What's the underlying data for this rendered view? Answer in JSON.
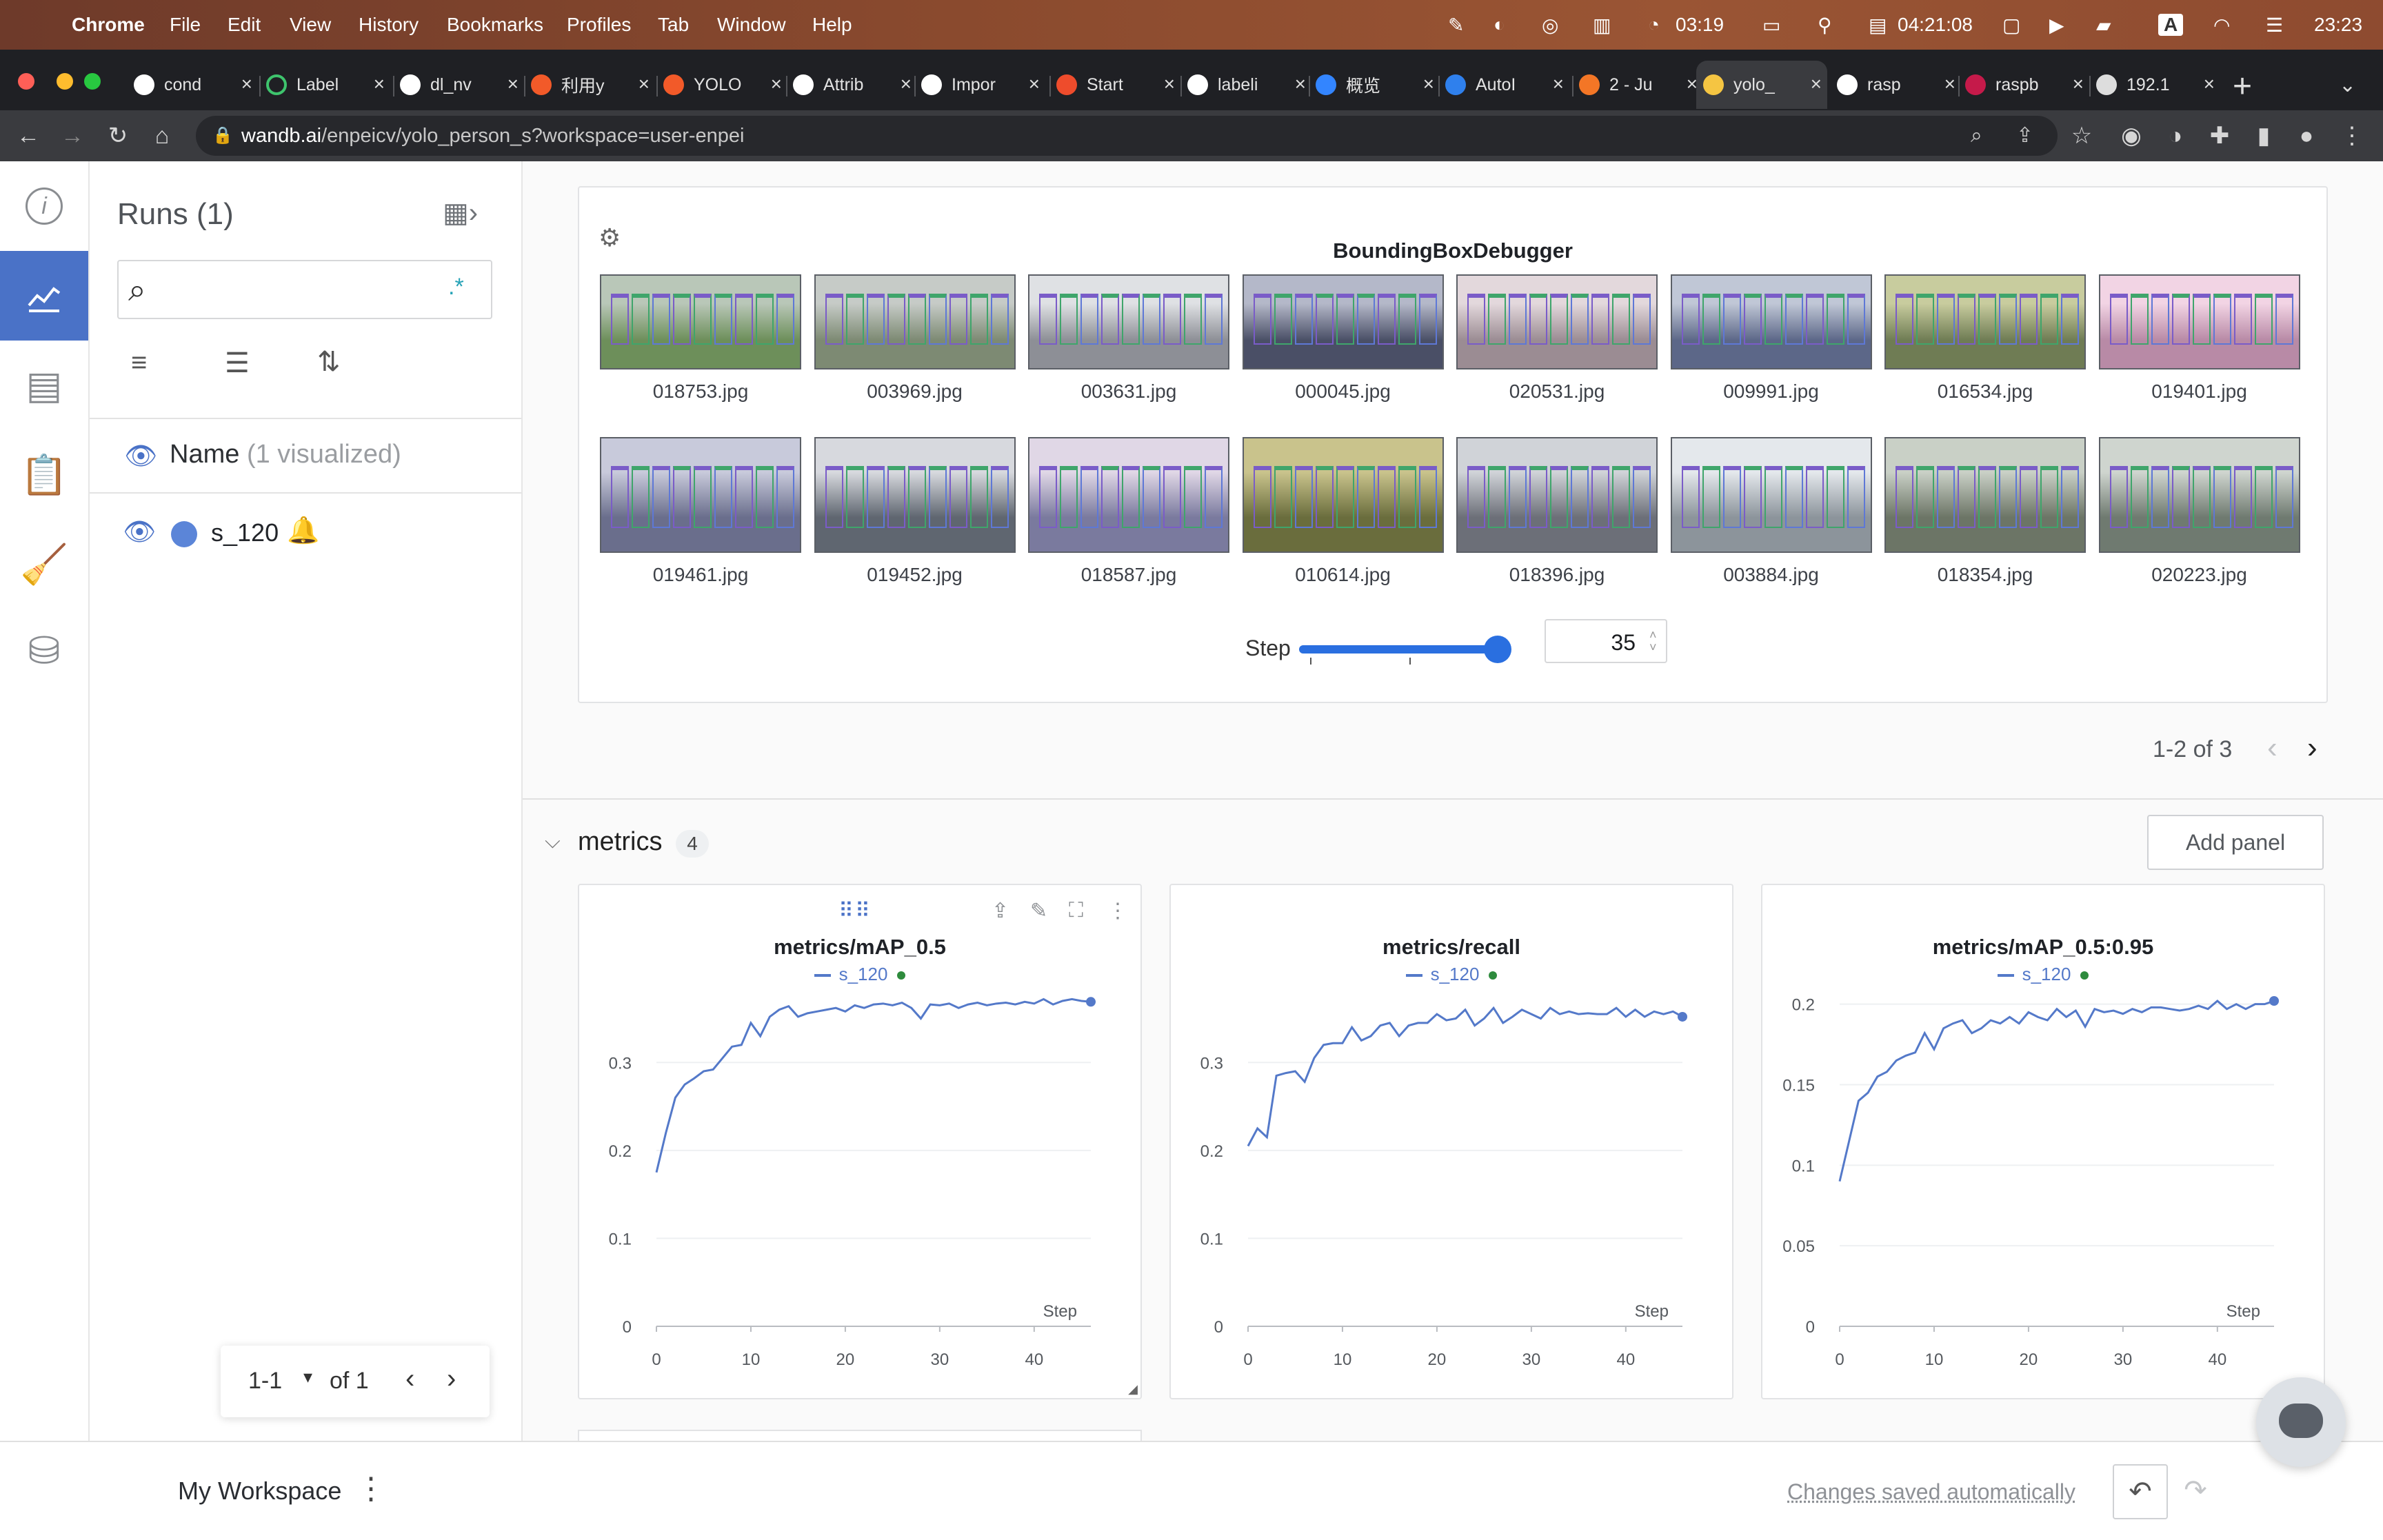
{
  "menubar": {
    "app": "Chrome",
    "items": [
      "File",
      "Edit",
      "View",
      "History",
      "Bookmarks",
      "Profiles",
      "Tab",
      "Window",
      "Help"
    ],
    "clock1": "03:19",
    "clock2": "04:21:08",
    "time": "23:23",
    "input_mode": "A"
  },
  "tabs": [
    {
      "label": "cond",
      "icon": "google-icon"
    },
    {
      "label": "Label",
      "icon": "spinner-icon"
    },
    {
      "label": "dl_nv",
      "icon": "github-icon"
    },
    {
      "label": "利用y",
      "icon": "csdn-icon"
    },
    {
      "label": "YOLO",
      "icon": "csdn-icon"
    },
    {
      "label": "Attrib",
      "icon": "google-icon"
    },
    {
      "label": "Impor",
      "icon": "github-icon"
    },
    {
      "label": "Start",
      "icon": "pytorch-icon"
    },
    {
      "label": "labeli",
      "icon": "google-icon"
    },
    {
      "label": "概览",
      "icon": "baidu-icon"
    },
    {
      "label": "AutoI",
      "icon": "vscode-icon"
    },
    {
      "label": "2 - Ju",
      "icon": "jupyter-icon"
    },
    {
      "label": "yolo_",
      "icon": "wandb-icon",
      "active": true
    },
    {
      "label": "rasp",
      "icon": "google-icon"
    },
    {
      "label": "raspb",
      "icon": "raspberry-icon"
    },
    {
      "label": "192.1",
      "icon": "page-icon"
    }
  ],
  "address": {
    "host": "wandb.ai",
    "path": "/enpeicv/yolo_person_s?workspace=user-enpei"
  },
  "runs": {
    "title": "Runs (1)",
    "column": "Name",
    "visualized": "(1 visualized)",
    "run_name": "s_120",
    "pager": {
      "range": "1-1",
      "of": "of 1"
    }
  },
  "bbox_panel": {
    "title": "BoundingBoxDebugger",
    "row1": [
      "018753.jpg",
      "003969.jpg",
      "003631.jpg",
      "000045.jpg",
      "020531.jpg",
      "009991.jpg",
      "016534.jpg",
      "019401.jpg"
    ],
    "row2": [
      "019461.jpg",
      "019452.jpg",
      "018587.jpg",
      "010614.jpg",
      "018396.jpg",
      "003884.jpg",
      "018354.jpg",
      "020223.jpg"
    ],
    "step_label": "Step",
    "step_value": "35",
    "step_fraction": 0.96
  },
  "pagination": "1-2 of 3",
  "section": {
    "title": "metrics",
    "count": "4",
    "add_panel": "Add panel"
  },
  "charts_meta": {
    "xlabel": "Step",
    "legend": "s_120",
    "line_color": "#5479c9"
  },
  "chart_data": [
    {
      "type": "line",
      "title": "metrics/mAP_0.5",
      "xlabel": "Step",
      "ylim": [
        0,
        0.37
      ],
      "xlim": [
        0,
        46
      ],
      "yticks": [
        0,
        0.1,
        0.2,
        0.3
      ],
      "ytick_labels": [
        "0",
        "0.1",
        "0.2",
        "0.3"
      ],
      "xticks": [
        0,
        10,
        20,
        30,
        40
      ],
      "series": [
        {
          "name": "s_120",
          "x": [
            0,
            1,
            2,
            3,
            4,
            5,
            6,
            7,
            8,
            9,
            10,
            11,
            12,
            13,
            14,
            15,
            16,
            17,
            18,
            19,
            20,
            21,
            22,
            23,
            24,
            25,
            26,
            27,
            28,
            29,
            30,
            31,
            32,
            33,
            34,
            35,
            36,
            37,
            38,
            39,
            40,
            41,
            42,
            43,
            44,
            45,
            46
          ],
          "values": [
            0.175,
            0.22,
            0.26,
            0.275,
            0.282,
            0.29,
            0.292,
            0.305,
            0.318,
            0.32,
            0.345,
            0.33,
            0.352,
            0.36,
            0.364,
            0.352,
            0.356,
            0.358,
            0.36,
            0.362,
            0.358,
            0.365,
            0.362,
            0.366,
            0.367,
            0.365,
            0.368,
            0.362,
            0.35,
            0.366,
            0.365,
            0.367,
            0.362,
            0.366,
            0.368,
            0.365,
            0.367,
            0.368,
            0.366,
            0.369,
            0.367,
            0.372,
            0.366,
            0.37,
            0.372,
            0.37,
            0.369
          ]
        }
      ]
    },
    {
      "type": "line",
      "title": "metrics/recall",
      "xlabel": "Step",
      "ylim": [
        0,
        0.37
      ],
      "xlim": [
        0,
        46
      ],
      "yticks": [
        0,
        0.1,
        0.2,
        0.3
      ],
      "ytick_labels": [
        "0",
        "0.1",
        "0.2",
        "0.3"
      ],
      "xticks": [
        0,
        10,
        20,
        30,
        40
      ],
      "series": [
        {
          "name": "s_120",
          "x": [
            0,
            1,
            2,
            3,
            4,
            5,
            6,
            7,
            8,
            9,
            10,
            11,
            12,
            13,
            14,
            15,
            16,
            17,
            18,
            19,
            20,
            21,
            22,
            23,
            24,
            25,
            26,
            27,
            28,
            29,
            30,
            31,
            32,
            33,
            34,
            35,
            36,
            37,
            38,
            39,
            40,
            41,
            42,
            43,
            44,
            45,
            46
          ],
          "values": [
            0.205,
            0.225,
            0.215,
            0.285,
            0.288,
            0.29,
            0.278,
            0.305,
            0.32,
            0.322,
            0.322,
            0.34,
            0.325,
            0.33,
            0.342,
            0.345,
            0.33,
            0.342,
            0.345,
            0.345,
            0.355,
            0.348,
            0.35,
            0.36,
            0.342,
            0.35,
            0.362,
            0.345,
            0.352,
            0.36,
            0.355,
            0.35,
            0.362,
            0.355,
            0.358,
            0.355,
            0.356,
            0.355,
            0.355,
            0.362,
            0.352,
            0.36,
            0.352,
            0.358,
            0.355,
            0.358,
            0.352
          ]
        }
      ]
    },
    {
      "type": "line",
      "title": "metrics/mAP_0.5:0.95",
      "xlabel": "Step",
      "ylim": [
        0,
        0.202
      ],
      "xlim": [
        0,
        46
      ],
      "yticks": [
        0,
        0.05,
        0.1,
        0.15,
        0.2
      ],
      "ytick_labels": [
        "0",
        "0.05",
        "0.1",
        "0.15",
        "0.2"
      ],
      "xticks": [
        0,
        10,
        20,
        30,
        40
      ],
      "series": [
        {
          "name": "s_120",
          "x": [
            0,
            1,
            2,
            3,
            4,
            5,
            6,
            7,
            8,
            9,
            10,
            11,
            12,
            13,
            14,
            15,
            16,
            17,
            18,
            19,
            20,
            21,
            22,
            23,
            24,
            25,
            26,
            27,
            28,
            29,
            30,
            31,
            32,
            33,
            34,
            35,
            36,
            37,
            38,
            39,
            40,
            41,
            42,
            43,
            44,
            45,
            46
          ],
          "values": [
            0.09,
            0.115,
            0.14,
            0.145,
            0.155,
            0.158,
            0.165,
            0.168,
            0.17,
            0.182,
            0.172,
            0.185,
            0.188,
            0.19,
            0.182,
            0.185,
            0.19,
            0.188,
            0.192,
            0.188,
            0.195,
            0.192,
            0.19,
            0.197,
            0.192,
            0.196,
            0.186,
            0.197,
            0.195,
            0.196,
            0.194,
            0.197,
            0.195,
            0.198,
            0.198,
            0.197,
            0.196,
            0.197,
            0.199,
            0.197,
            0.202,
            0.197,
            0.2,
            0.197,
            0.2,
            0.2,
            0.202
          ]
        }
      ]
    }
  ],
  "footer": {
    "workspace": "My Workspace",
    "saved": "Changes saved automatically"
  }
}
